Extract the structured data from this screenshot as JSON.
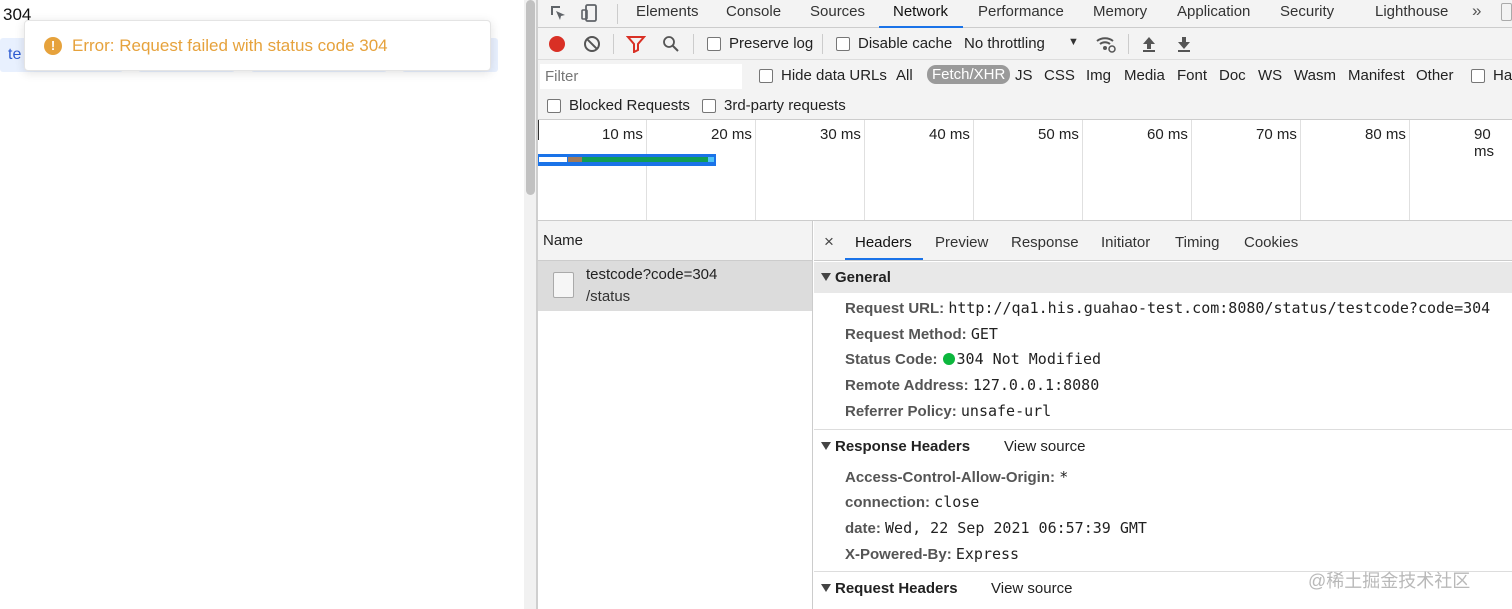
{
  "page": {
    "status_number": "304",
    "button_text": "te",
    "toast": {
      "icon": "warning-icon",
      "message": "Error: Request failed with status code 304",
      "color": "#e6a23c"
    }
  },
  "devtools": {
    "tabs": [
      "Elements",
      "Console",
      "Sources",
      "Network",
      "Performance",
      "Memory",
      "Application",
      "Security",
      "Lighthouse"
    ],
    "active_tab": "Network",
    "more_tabs": "»",
    "toolbar": {
      "preserve_log": "Preserve log",
      "disable_cache": "Disable cache",
      "throttling": "No throttling"
    },
    "filter": {
      "placeholder": "Filter",
      "hide_data_urls": "Hide data URLs",
      "types": [
        "All",
        "Fetch/XHR",
        "JS",
        "CSS",
        "Img",
        "Media",
        "Font",
        "Doc",
        "WS",
        "Wasm",
        "Manifest",
        "Other"
      ],
      "active_type": "Fetch/XHR",
      "has_blocked_cookies": "Ha",
      "blocked_requests": "Blocked Requests",
      "third_party": "3rd-party requests"
    },
    "overview": {
      "ticks": [
        "10 ms",
        "20 ms",
        "30 ms",
        "40 ms",
        "50 ms",
        "60 ms",
        "70 ms",
        "80 ms",
        "90 ms"
      ]
    },
    "name_column": {
      "header": "Name",
      "request_name": "testcode?code=304",
      "request_path": "/status"
    },
    "detail": {
      "close": "×",
      "tabs": [
        "Headers",
        "Preview",
        "Response",
        "Initiator",
        "Timing",
        "Cookies"
      ],
      "active_tab": "Headers",
      "general": {
        "title": "General",
        "request_url_key": "Request URL:",
        "request_url": "http://qa1.his.guahao-test.com:8080/status/testcode?code=304",
        "method_key": "Request Method:",
        "method": "GET",
        "status_key": "Status Code:",
        "status": "304 Not Modified",
        "remote_key": "Remote Address:",
        "remote": "127.0.0.1:8080",
        "referrer_key": "Referrer Policy:",
        "referrer": "unsafe-url"
      },
      "response_headers": {
        "title": "Response Headers",
        "view_source": "View source",
        "acao_key": "Access-Control-Allow-Origin:",
        "acao": "*",
        "connection_key": "connection:",
        "connection": "close",
        "date_key": "date:",
        "date": "Wed, 22 Sep 2021 06:57:39 GMT",
        "powered_key": "X-Powered-By:",
        "powered": "Express"
      },
      "request_headers": {
        "title": "Request Headers",
        "view_source": "View source"
      }
    }
  },
  "watermark": "@稀土掘金技术社区"
}
